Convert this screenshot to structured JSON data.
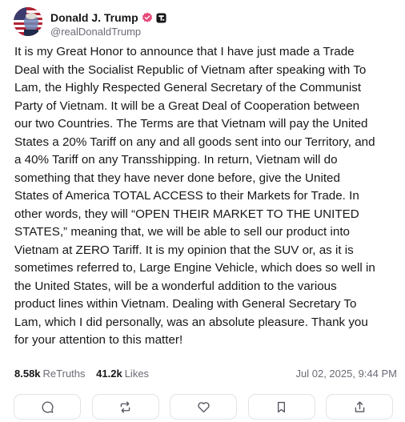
{
  "author": {
    "display_name": "Donald J. Trump",
    "handle": "@realDonaldTrump",
    "avatar_icon": "avatar-flag-portrait",
    "verified_icon": "verified-badge-icon",
    "badge_icon": "truth-social-badge-icon"
  },
  "post": {
    "text": "It is my Great Honor to announce that I have just made a Trade\nDeal with the Socialist Republic of Vietnam after speaking with To\nLam, the Highly Respected General Secretary of the Communist\nParty of Vietnam. It will be a Great Deal of Cooperation between\nour two Countries. The Terms are that Vietnam will pay the United\nStates a 20% Tariff on any and all goods sent into our Territory, and\na 40% Tariff on any Transshipping. In return, Vietnam will do\nsomething that they have never done before, give the United\nStates of America TOTAL ACCESS to their Markets for Trade. In\nother words, they will “OPEN THEIR MARKET TO THE UNITED\nSTATES,” meaning that, we will be able to sell our product into\nVietnam at ZERO Tariff. It is my opinion that the SUV or, as it is\nsometimes referred to, Large Engine Vehicle, which does so well in\nthe United States, will be a wonderful addition to the various\nproduct lines within Vietnam. Dealing with General Secretary To\nLam, which I did personally, was an absolute pleasure. Thank you\nfor your attention to this matter!"
  },
  "stats": {
    "retruths_count": "8.58k",
    "retruths_label": "ReTruths",
    "likes_count": "41.2k",
    "likes_label": "Likes",
    "timestamp": "Jul 02, 2025, 9:44 PM"
  },
  "actions": [
    {
      "name": "reply",
      "icon": "comment-icon"
    },
    {
      "name": "retruth",
      "icon": "retruth-icon"
    },
    {
      "name": "like",
      "icon": "heart-icon"
    },
    {
      "name": "bookmark",
      "icon": "bookmark-icon"
    },
    {
      "name": "share",
      "icon": "share-icon"
    }
  ],
  "colors": {
    "verified_badge": "#e6497a",
    "text_primary": "#17171a",
    "text_secondary": "#6b6b76",
    "border": "#e3e3e8"
  }
}
